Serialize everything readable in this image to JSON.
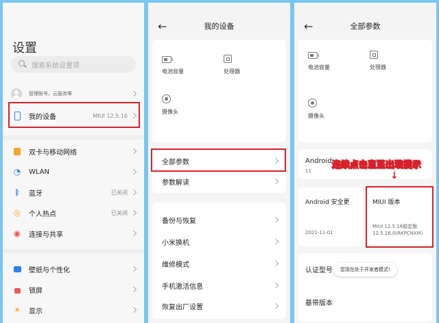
{
  "panel1": {
    "title": "设置",
    "search_placeholder": "搜索系统设置项",
    "account_label": "管理账号，云服务等",
    "my_device": {
      "label": "我的设备",
      "value": "MIUI 12.5.16"
    },
    "items": [
      {
        "label": "双卡与移动网络",
        "value": "",
        "icon": "sim-card-icon",
        "color": "#f5a623"
      },
      {
        "label": "WLAN",
        "value": "",
        "icon": "wifi-icon",
        "color": "#2f80ed"
      },
      {
        "label": "蓝牙",
        "value": "已关闭",
        "icon": "bluetooth-icon",
        "color": "#2f80ed"
      },
      {
        "label": "个人热点",
        "value": "已关闭",
        "icon": "hotspot-icon",
        "color": "#f5a623"
      },
      {
        "label": "连接与共享",
        "value": "",
        "icon": "share-icon",
        "color": "#eb5757"
      },
      {
        "label": "壁纸与个性化",
        "value": "",
        "icon": "wallpaper-icon",
        "color": "#2f80ed"
      },
      {
        "label": "锁屏",
        "value": "",
        "icon": "lock-icon",
        "color": "#eb5757"
      },
      {
        "label": "显示",
        "value": "",
        "icon": "display-icon",
        "color": "#f5a623"
      }
    ]
  },
  "panel2": {
    "title": "我的设备",
    "back_icon": "←",
    "cells": {
      "battery": "电池容量",
      "cpu": "处理器",
      "camera": "摄像头"
    },
    "rows": [
      "全部参数",
      "参数解读",
      "备份与恢复",
      "小米换机",
      "维修模式",
      "手机激活信息",
      "恢复出厂设置"
    ]
  },
  "panel3": {
    "title": "全部参数",
    "back_icon": "←",
    "cells": {
      "battery": "电池容量",
      "cpu": "处理器",
      "camera": "摄像头"
    },
    "android_version": {
      "label": "Android",
      "value": "11"
    },
    "android_security": {
      "label": "Android 安全更",
      "value": "2021-11-01"
    },
    "miui": {
      "label": "MIUI 版本",
      "line1": "MIUI 12.5.16稳定版",
      "line2": "12.5.16.0(RKPCNXM)"
    },
    "cert_label": "认证型号",
    "baseband_label": "基带版本",
    "toast": "您现在处于开发者模式!",
    "annotation": "连续点击直至出现提示",
    "annotation_arrow": "↓"
  },
  "colors": {
    "highlight": "#d6212b",
    "background": "#79c6ef"
  }
}
